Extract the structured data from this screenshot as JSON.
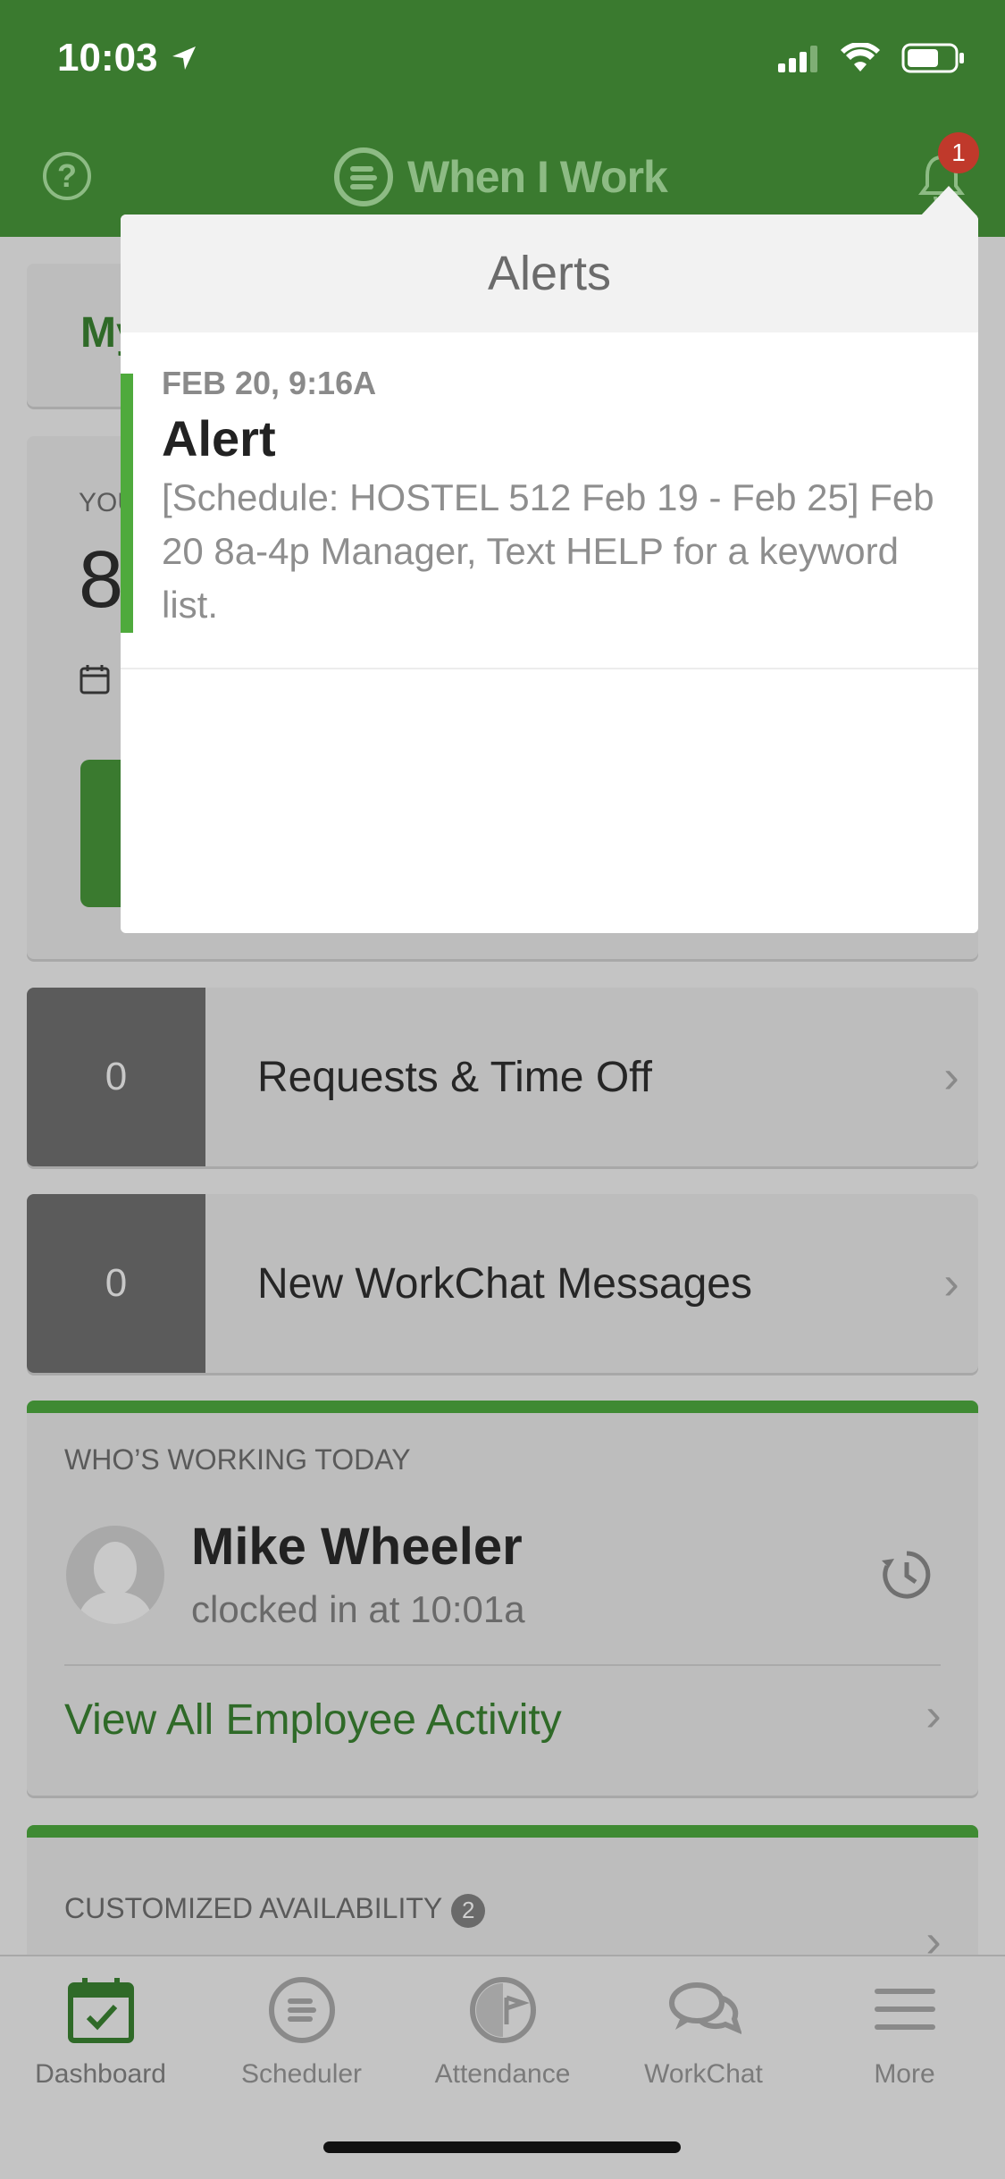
{
  "status_bar": {
    "time": "10:03"
  },
  "header": {
    "help_label": "?",
    "brand": "When I Work",
    "notification_count": "1"
  },
  "background": {
    "card1_partial_text": "My",
    "card2_partial_label": "YOU",
    "card2_partial_number": "8"
  },
  "counters": [
    {
      "count": "0",
      "label": "Requests & Time Off"
    },
    {
      "count": "0",
      "label": "New WorkChat Messages"
    }
  ],
  "whos_working": {
    "title": "WHO’S WORKING TODAY",
    "name": "Mike Wheeler",
    "status": "clocked in at 10:01a",
    "view_all": "View All Employee Activity"
  },
  "availability": {
    "title": "CUSTOMIZED AVAILABILITY",
    "count": "2"
  },
  "alerts": {
    "title": "Alerts",
    "items": [
      {
        "time": "FEB 20, 9:16A",
        "title": "Alert",
        "body": "[Schedule: HOSTEL 512 Feb 19 - Feb 25] Feb 20 8a-4p Manager, Text HELP for a keyword list."
      }
    ]
  },
  "tabs": [
    {
      "label": "Dashboard",
      "icon": "calendar-check-icon"
    },
    {
      "label": "Scheduler",
      "icon": "scheduler-icon"
    },
    {
      "label": "Attendance",
      "icon": "attendance-icon"
    },
    {
      "label": "WorkChat",
      "icon": "chat-bubbles-icon"
    },
    {
      "label": "More",
      "icon": "hamburger-menu-icon"
    }
  ],
  "colors": {
    "brand_green": "#3a7a2f",
    "accent_green": "#4faa3c",
    "badge_red": "#c0392b"
  }
}
